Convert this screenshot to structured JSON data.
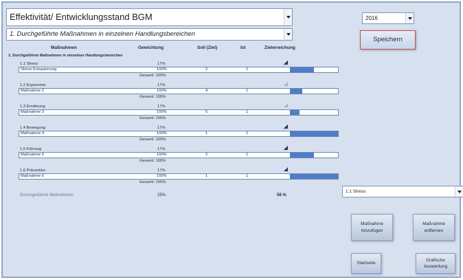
{
  "header": {
    "title": "Effektivität/ Entwicklungsstand BGM",
    "area": "1. Durchgeführte Maßnahmen in einzelnen Handlungsbereichen",
    "year": "2016",
    "save_label": "Speichern"
  },
  "columns": {
    "measures": "Maßnahmen",
    "weight": "Gewichtung",
    "target": "Soll (Ziel)",
    "actual": "Ist",
    "achievement": "Zielerreichung"
  },
  "section_title": "1. Durchgeführte Maßnahmen in einzelnen Handlungsbereichen",
  "groups": [
    {
      "name": "1.1 Stress",
      "weight": "17%",
      "icon": "signal-low-icon",
      "measure": "Stress Entspannung",
      "m_weight": "100%",
      "soll": "2",
      "ist": "1",
      "achievement": 0.5,
      "total": "Gesamt: 100%"
    },
    {
      "name": "1.2 Ergonomie",
      "weight": "17%",
      "icon": "signal-faint-icon",
      "measure": "Maßnahme 2",
      "m_weight": "100%",
      "soll": "4",
      "ist": "1",
      "achievement": 0.25,
      "total": "Gesamt: 100%"
    },
    {
      "name": "1.3 Ernährung",
      "weight": "17%",
      "icon": "signal-faint-icon",
      "measure": "Maßnahme 3",
      "m_weight": "100%",
      "soll": "5",
      "ist": "1",
      "achievement": 0.2,
      "total": "Gesamt: 100%"
    },
    {
      "name": "1.4 Bewegung",
      "weight": "17%",
      "icon": "signal-full-icon",
      "measure": "Maßnahme 4",
      "m_weight": "100%",
      "soll": "1",
      "ist": "1",
      "achievement": 1.0,
      "total": "Gesamt: 100%"
    },
    {
      "name": "1.5 Führung",
      "weight": "17%",
      "icon": "signal-low-icon",
      "measure": "Maßnahme 5",
      "m_weight": "100%",
      "soll": "2",
      "ist": "1",
      "achievement": 0.5,
      "total": "Gesamt: 100%"
    },
    {
      "name": "1.6 Prävention",
      "weight": "17%",
      "icon": "signal-full-icon",
      "measure": "Maßnahme 6",
      "m_weight": "100%",
      "soll": "1",
      "ist": "1",
      "achievement": 1.0,
      "total": "Gesamt: 100%"
    }
  ],
  "summary": {
    "label": "Durchgeführte Maßnahmen",
    "weight": "25%",
    "achievement": "58 %"
  },
  "side": {
    "filter_value": "1.1 Stress",
    "add_label": "Maßnahme hinzufügen",
    "remove_label": "Maßnahme entfernen",
    "start_label": "Startseite",
    "chart_label": "Grafische Auswertung"
  },
  "colors": {
    "bar": "#4f7ec8",
    "background": "#d6e0ee",
    "save_border": "#c0504d"
  }
}
